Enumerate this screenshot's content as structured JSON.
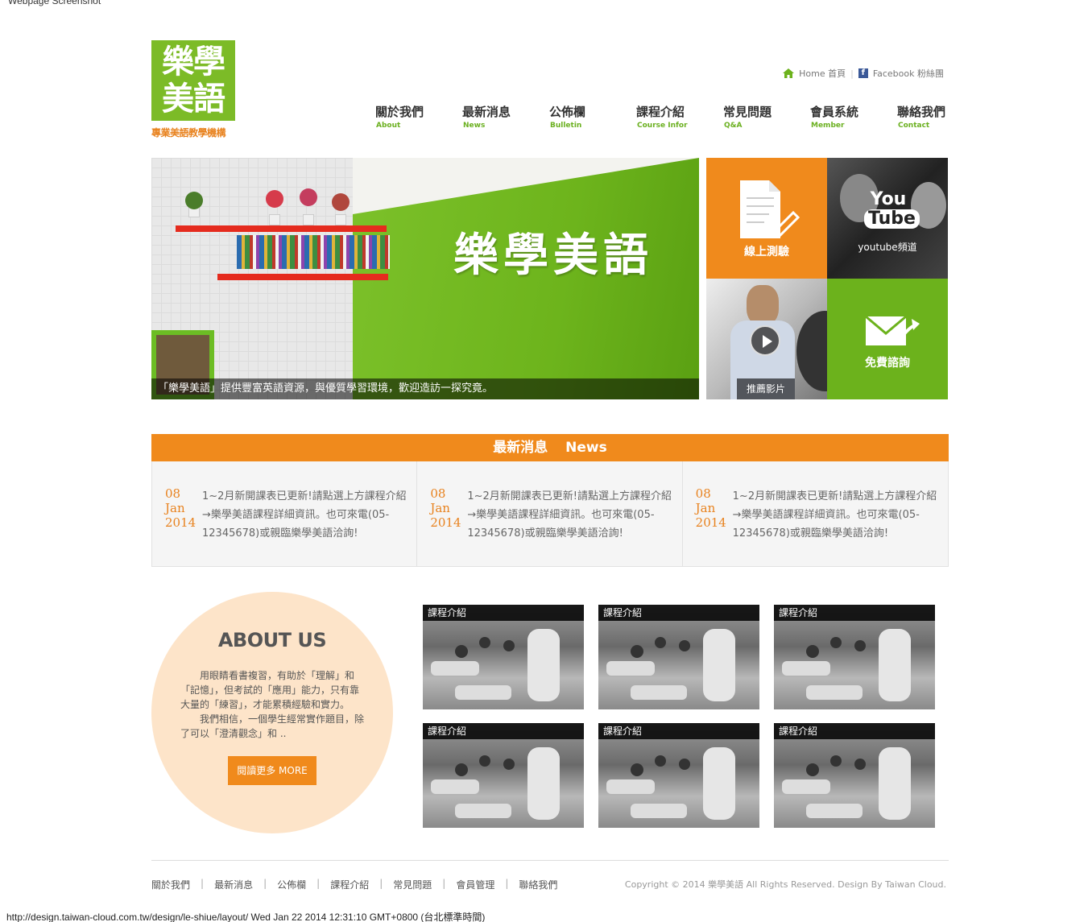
{
  "header": {
    "logo_text": "樂學美語",
    "logo_line1": "樂學",
    "logo_line2": "美語",
    "tagline": "專業美語教學機構",
    "home_link": "Home 首頁",
    "facebook_link": "Facebook 粉絲團"
  },
  "nav": [
    {
      "zh": "關於我們",
      "en": "About"
    },
    {
      "zh": "最新消息",
      "en": "News"
    },
    {
      "zh": "公佈欄",
      "en": "Bulletin"
    },
    {
      "zh": "課程介紹",
      "en": "Course Infor"
    },
    {
      "zh": "常見問題",
      "en": "Q&A"
    },
    {
      "zh": "會員系統",
      "en": "Member"
    },
    {
      "zh": "聯絡我們",
      "en": "Contact"
    }
  ],
  "hero": {
    "title": "樂學美語",
    "caption": "「樂學美語」提供豐富英語資源，與優質學習環境，歡迎造訪一探究竟。"
  },
  "tiles": {
    "test": "線上測驗",
    "youtube_logo_top": "You",
    "youtube_logo_bottom": "Tube",
    "youtube": "youtube頻道",
    "video": "推薦影片",
    "contact": "免費諮詢"
  },
  "news": {
    "title_zh": "最新消息",
    "title_en": "News",
    "items": [
      {
        "day": "08",
        "month": "Jan",
        "year": "2014",
        "text": "1~2月新開課表已更新!請點選上方課程介紹→樂學美語課程詳細資訊。也可來電(05-12345678)或親臨樂學美語洽詢!"
      },
      {
        "day": "08",
        "month": "Jan",
        "year": "2014",
        "text": "1~2月新開課表已更新!請點選上方課程介紹→樂學美語課程詳細資訊。也可來電(05-12345678)或親臨樂學美語洽詢!"
      },
      {
        "day": "08",
        "month": "Jan",
        "year": "2014",
        "text": "1~2月新開課表已更新!請點選上方課程介紹→樂學美語課程詳細資訊。也可來電(05-12345678)或親臨樂學美語洽詢!"
      }
    ]
  },
  "about": {
    "title": "ABOUT US",
    "para1": "用眼睛看書複習，有助於「理解」和「記憶」，但考試的「應用」能力，只有靠大量的「練習」，才能累積經驗和實力。",
    "para2": "我們相信，一個學生經常實作題目，除了可以「澄清觀念」和 ..",
    "more": "閱讀更多 MORE"
  },
  "courses": [
    "課程介紹",
    "課程介紹",
    "課程介紹",
    "課程介紹",
    "課程介紹",
    "課程介紹"
  ],
  "footer": {
    "links": [
      "關於我們",
      "最新消息",
      "公佈欄",
      "課程介紹",
      "常見問題",
      "會員管理",
      "聯絡我們"
    ],
    "copyright": "Copyright © 2014 樂學美語 All Rights Reserved. Design By Taiwan Cloud."
  },
  "captions": {
    "top": "Webpage Screenshot",
    "bottom": "http://design.taiwan-cloud.com.tw/design/le-shiue/layout/ Wed Jan 22 2014 12:31:10 GMT+0800 (台北標準時間)"
  },
  "colors": {
    "green": "#6cb21c",
    "orange": "#f08a1c"
  }
}
